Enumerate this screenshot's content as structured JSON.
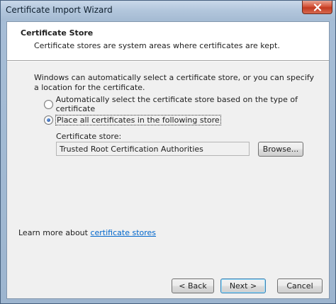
{
  "window": {
    "title": "Certificate Import Wizard"
  },
  "header": {
    "title": "Certificate Store",
    "subtitle": "Certificate stores are system areas where certificates are kept."
  },
  "intro": "Windows can automatically select a certificate store, or you can specify a location for the certificate.",
  "options": [
    {
      "label": "Automatically select the certificate store based on the type of certificate",
      "checked": false
    },
    {
      "label": "Place all certificates in the following store",
      "checked": true
    }
  ],
  "store": {
    "label": "Certificate store:",
    "value": "Trusted Root Certification Authorities",
    "browse_label": "Browse..."
  },
  "learn_more": {
    "prefix": "Learn more about ",
    "link": "certificate stores"
  },
  "footer": {
    "back_label": "< Back",
    "next_label": "Next >",
    "cancel_label": "Cancel"
  },
  "colors": {
    "link": "#0066cc",
    "close_button": "#c23a20"
  }
}
